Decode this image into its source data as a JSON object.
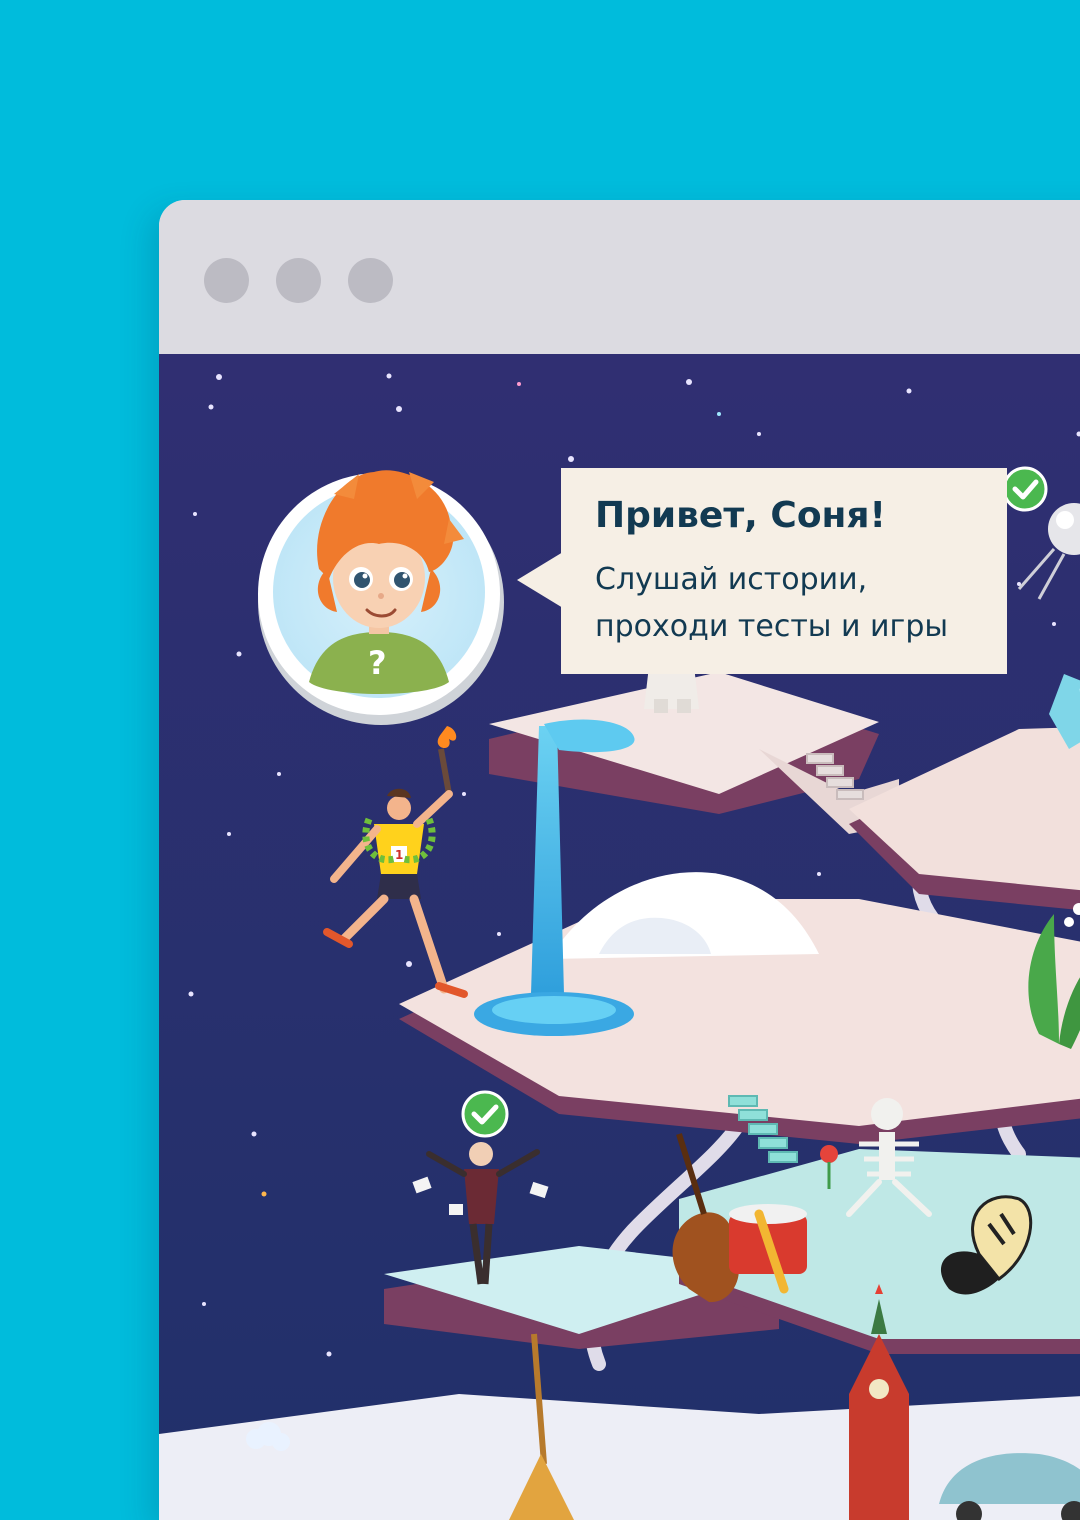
{
  "greeting": {
    "title": "Привет, Соня!",
    "line1": "Слушай истории,",
    "line2": "проходи тесты и игры"
  },
  "icons": {
    "avatar": "boy-avatar-with-question-mark",
    "done": "check-icon"
  },
  "colors": {
    "background": "#00bcdc",
    "window_chrome": "#dcdbe1",
    "window_button": "#bcbbc3",
    "night_sky": "#27306b",
    "bubble": "#f6efe5",
    "bubble_text": "#123a52",
    "check_badge": "#4bb84f"
  }
}
